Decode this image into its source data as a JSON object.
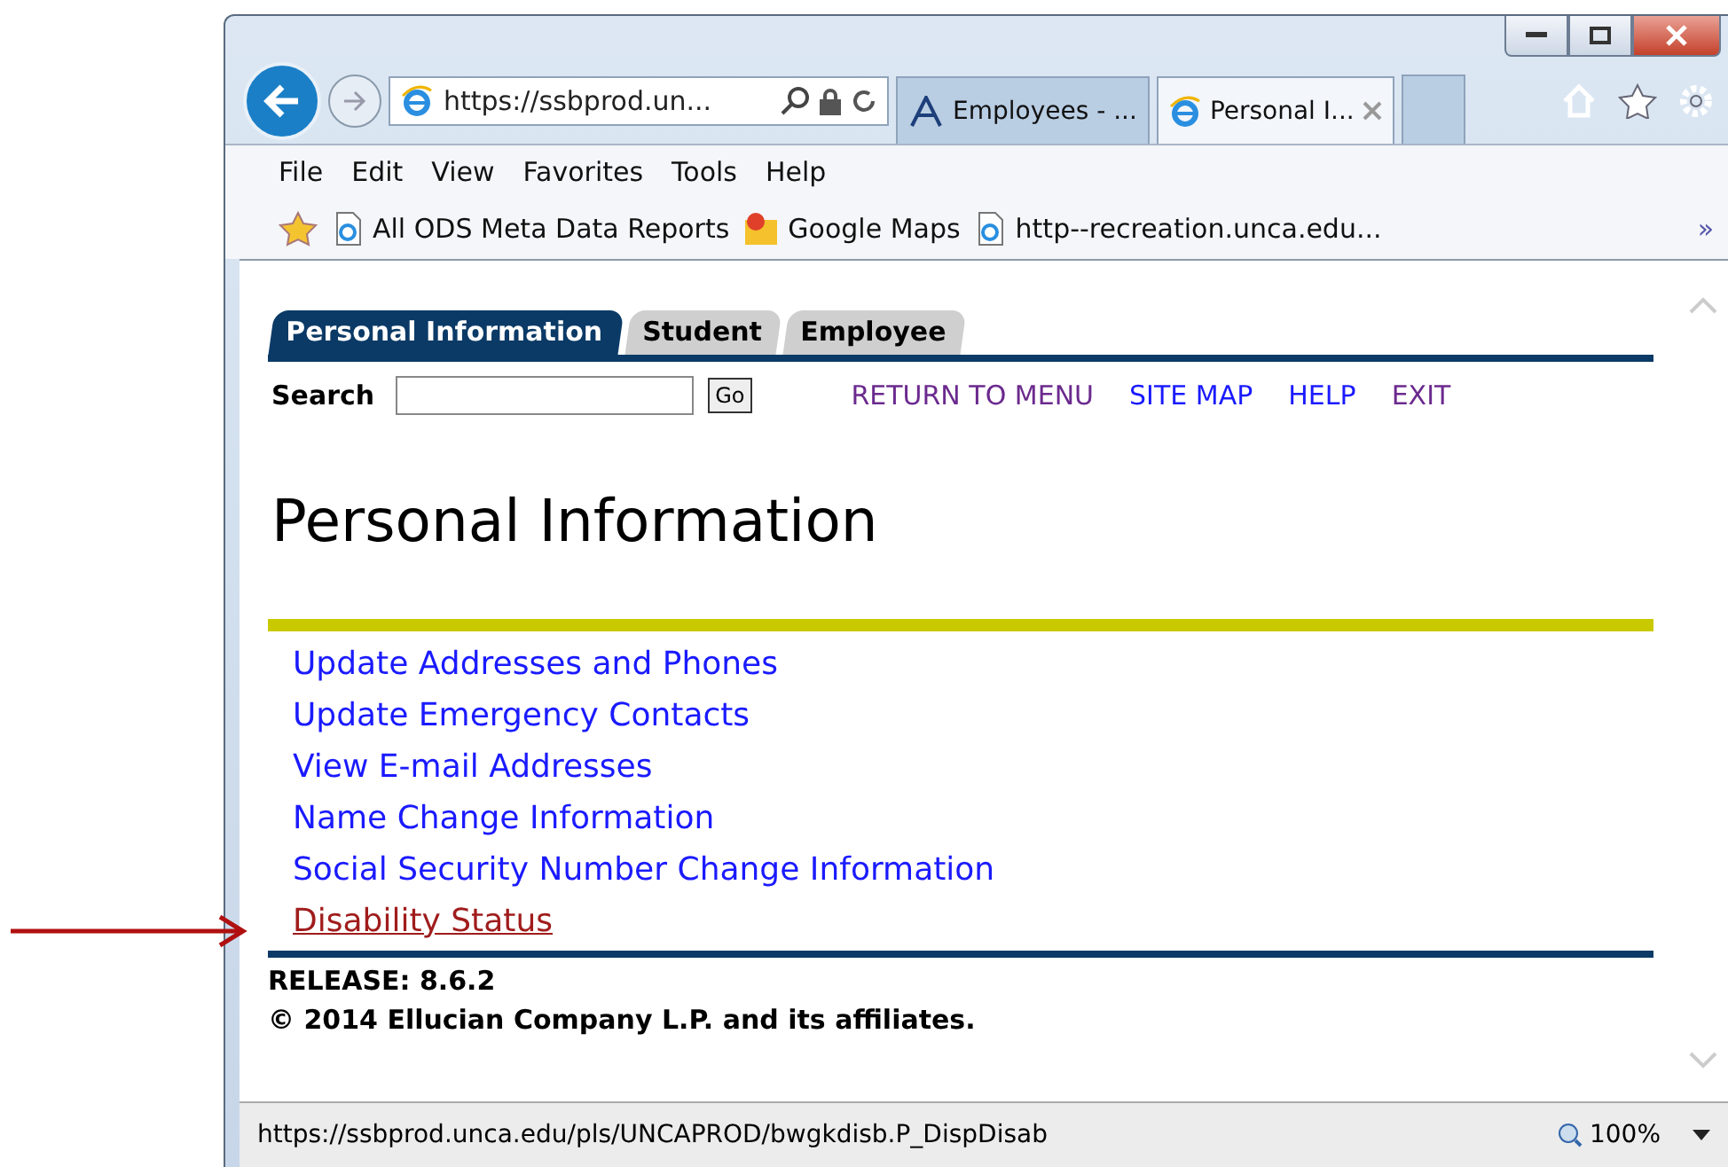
{
  "browser": {
    "address": "https://ssbprod.un...",
    "tabs": [
      {
        "label": "Employees - ...",
        "kind": "doc",
        "selected": false
      },
      {
        "label": "Personal I...",
        "kind": "ie",
        "selected": true
      }
    ],
    "menu": [
      "File",
      "Edit",
      "View",
      "Favorites",
      "Tools",
      "Help"
    ],
    "favorites": [
      {
        "label": "All ODS Meta Data Reports",
        "kind": "page"
      },
      {
        "label": "Google Maps",
        "kind": "maps"
      },
      {
        "label": "http--recreation.unca.edu...",
        "kind": "page"
      }
    ],
    "overflow": "»",
    "status_url": "https://ssbprod.unca.edu/pls/UNCAPROD/bwgkdisb.P_DispDisab",
    "zoom": "100%"
  },
  "page": {
    "tabs": [
      {
        "label": "Personal Information",
        "selected": true
      },
      {
        "label": "Student",
        "selected": false
      },
      {
        "label": "Employee",
        "selected": false
      }
    ],
    "search": {
      "label": "Search",
      "button": "Go"
    },
    "nav_links": [
      {
        "label": "RETURN TO MENU",
        "visited": true
      },
      {
        "label": "SITE MAP",
        "visited": false
      },
      {
        "label": "HELP",
        "visited": false
      },
      {
        "label": "EXIT",
        "visited": true
      }
    ],
    "heading": "Personal Information",
    "links": [
      {
        "label": "Update Addresses and Phones",
        "hovered": false
      },
      {
        "label": "Update Emergency Contacts",
        "hovered": false
      },
      {
        "label": "View E-mail Addresses",
        "hovered": false
      },
      {
        "label": "Name Change Information",
        "hovered": false
      },
      {
        "label": "Social Security Number Change Information",
        "hovered": false
      },
      {
        "label": "Disability Status",
        "hovered": true
      }
    ],
    "release": "RELEASE: 8.6.2",
    "copyright": "© 2014 Ellucian Company L.P. and its affiliates."
  }
}
